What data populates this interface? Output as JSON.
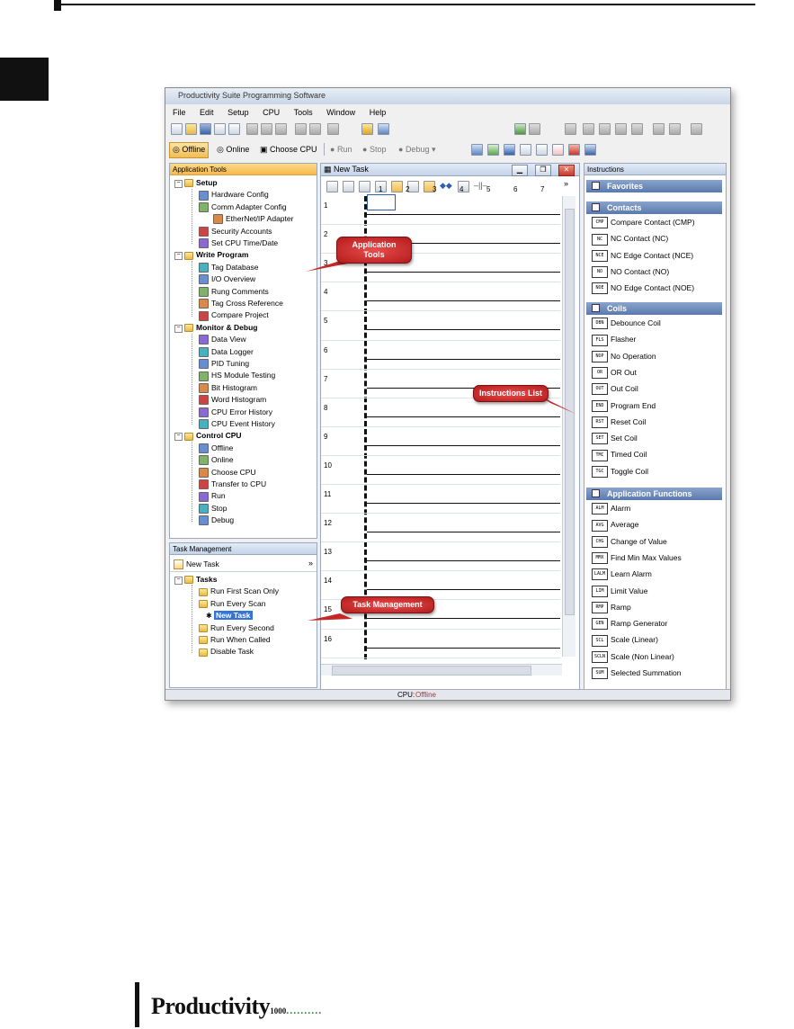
{
  "window": {
    "title": "Productivity Suite Programming Software"
  },
  "menu": [
    "File",
    "Edit",
    "Setup",
    "CPU",
    "Tools",
    "Window",
    "Help"
  ],
  "toolbar2": {
    "offline": "Offline",
    "online": "Online",
    "choose_cpu": "Choose CPU",
    "run": "Run",
    "stop": "Stop",
    "debug": "Debug"
  },
  "app_tools": {
    "header": "Application Tools",
    "groups": [
      {
        "label": "Setup",
        "items": [
          "Hardware Config",
          "Comm Adapter Config",
          "EtherNet/IP Adapter",
          "Security Accounts",
          "Set CPU Time/Date"
        ]
      },
      {
        "label": "Write Program",
        "items": [
          "Tag Database",
          "I/O Overview",
          "Rung Comments",
          "Tag Cross Reference",
          "Compare Project"
        ]
      },
      {
        "label": "Monitor & Debug",
        "items": [
          "Data View",
          "Data Logger",
          "PID Tuning",
          "HS Module Testing",
          "Bit Histogram",
          "Word Histogram",
          "CPU Error History",
          "CPU Event History"
        ]
      },
      {
        "label": "Control CPU",
        "items": [
          "Offline",
          "Online",
          "Choose CPU",
          "Transfer to CPU",
          "Run",
          "Stop",
          "Debug"
        ]
      }
    ]
  },
  "task_mgmt": {
    "header": "Task Management",
    "new_task": "New Task",
    "tasks_label": "Tasks",
    "items": [
      "Run First Scan Only",
      "Run Every Scan",
      "New Task",
      "Run Every Second",
      "Run When Called",
      "Disable Task"
    ]
  },
  "editor": {
    "title": "New Task",
    "columns": [
      "1",
      "2",
      "3",
      "4",
      "5",
      "6",
      "7"
    ],
    "rows": [
      "1",
      "2",
      "3",
      "4",
      "5",
      "6",
      "7",
      "8",
      "9",
      "10",
      "11",
      "12",
      "13",
      "14",
      "15",
      "16"
    ]
  },
  "instructions": {
    "header": "Instructions",
    "favorites": "Favorites",
    "contacts": {
      "label": "Contacts",
      "items": [
        {
          "code": "CMP",
          "label": "Compare Contact  (CMP)"
        },
        {
          "code": "NC",
          "label": "NC Contact  (NC)"
        },
        {
          "code": "NCE",
          "label": "NC Edge Contact  (NCE)"
        },
        {
          "code": "NO",
          "label": "NO Contact  (NO)"
        },
        {
          "code": "NOE",
          "label": "NO Edge Contact  (NOE)"
        }
      ]
    },
    "coils": {
      "label": "Coils",
      "items": [
        {
          "code": "DBN",
          "label": "Debounce Coil"
        },
        {
          "code": "FLS",
          "label": "Flasher"
        },
        {
          "code": "NOP",
          "label": "No Operation"
        },
        {
          "code": "OR",
          "label": "OR Out"
        },
        {
          "code": "OUT",
          "label": "Out Coil"
        },
        {
          "code": "END",
          "label": "Program End"
        },
        {
          "code": "RST",
          "label": "Reset Coil"
        },
        {
          "code": "SET",
          "label": "Set Coil"
        },
        {
          "code": "TMC",
          "label": "Timed Coil"
        },
        {
          "code": "TGC",
          "label": "Toggle Coil"
        }
      ]
    },
    "app_functions": {
      "label": "Application Functions",
      "items": [
        {
          "code": "ALM",
          "label": "Alarm"
        },
        {
          "code": "AVG",
          "label": "Average"
        },
        {
          "code": "CHG",
          "label": "Change of Value"
        },
        {
          "code": "MMX",
          "label": "Find Min Max Values"
        },
        {
          "code": "LALM",
          "label": "Learn Alarm"
        },
        {
          "code": "LIM",
          "label": "Limit Value"
        },
        {
          "code": "RMP",
          "label": "Ramp"
        },
        {
          "code": "GEN",
          "label": "Ramp Generator"
        },
        {
          "code": "SCL",
          "label": "Scale (Linear)"
        },
        {
          "code": "SCLN",
          "label": "Scale (Non Linear)"
        },
        {
          "code": "SUM",
          "label": "Selected Summation"
        }
      ]
    }
  },
  "status": {
    "cpu": "CPU:",
    "mode": "Offline"
  },
  "callouts": {
    "app_tools": "Application Tools",
    "instructions": "Instructions List",
    "task_mgmt": "Task Management"
  },
  "logo": {
    "brand": "Productivity",
    "series": "1000"
  },
  "colors": {
    "accent": "#c62828",
    "selection": "#3375d6",
    "header_orange": "#f6b94c"
  }
}
